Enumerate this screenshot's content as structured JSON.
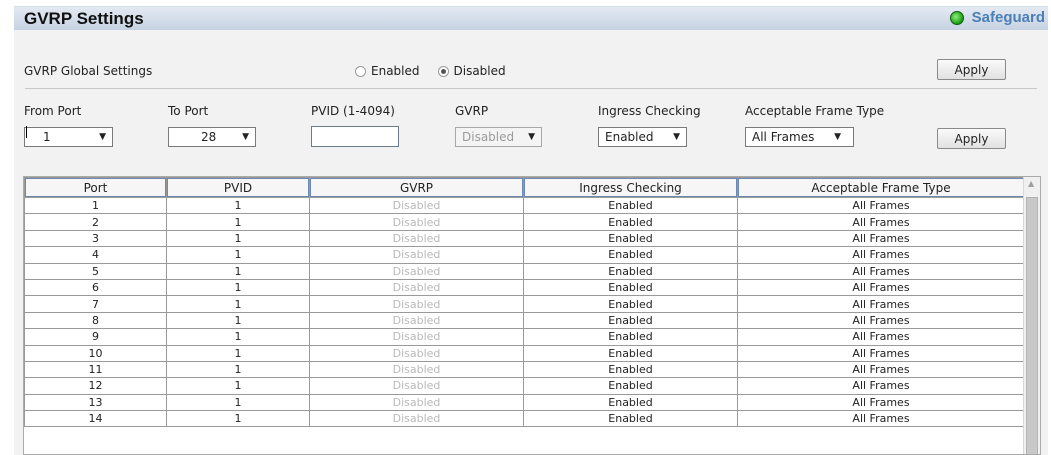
{
  "header": {
    "title": "GVRP Settings",
    "badge": "Safeguard"
  },
  "global": {
    "label": "GVRP Global Settings",
    "options": [
      "Enabled",
      "Disabled"
    ],
    "selected": "Disabled",
    "apply_label": "Apply"
  },
  "form": {
    "from_port": {
      "label": "From Port",
      "value": "1"
    },
    "to_port": {
      "label": "To Port",
      "value": "28"
    },
    "pvid": {
      "label": "PVID (1-4094)",
      "value": ""
    },
    "gvrp": {
      "label": "GVRP",
      "value": "Disabled"
    },
    "ingress": {
      "label": "Ingress Checking",
      "value": "Enabled"
    },
    "frame_type": {
      "label": "Acceptable Frame Type",
      "value": "All Frames"
    },
    "apply_label": "Apply"
  },
  "table": {
    "columns": [
      "Port",
      "PVID",
      "GVRP",
      "Ingress Checking",
      "Acceptable Frame Type"
    ],
    "rows": [
      [
        "1",
        "1",
        "Disabled",
        "Enabled",
        "All Frames"
      ],
      [
        "2",
        "1",
        "Disabled",
        "Enabled",
        "All Frames"
      ],
      [
        "3",
        "1",
        "Disabled",
        "Enabled",
        "All Frames"
      ],
      [
        "4",
        "1",
        "Disabled",
        "Enabled",
        "All Frames"
      ],
      [
        "5",
        "1",
        "Disabled",
        "Enabled",
        "All Frames"
      ],
      [
        "6",
        "1",
        "Disabled",
        "Enabled",
        "All Frames"
      ],
      [
        "7",
        "1",
        "Disabled",
        "Enabled",
        "All Frames"
      ],
      [
        "8",
        "1",
        "Disabled",
        "Enabled",
        "All Frames"
      ],
      [
        "9",
        "1",
        "Disabled",
        "Enabled",
        "All Frames"
      ],
      [
        "10",
        "1",
        "Disabled",
        "Enabled",
        "All Frames"
      ],
      [
        "11",
        "1",
        "Disabled",
        "Enabled",
        "All Frames"
      ],
      [
        "12",
        "1",
        "Disabled",
        "Enabled",
        "All Frames"
      ],
      [
        "13",
        "1",
        "Disabled",
        "Enabled",
        "All Frames"
      ],
      [
        "14",
        "1",
        "Disabled",
        "Enabled",
        "All Frames"
      ]
    ]
  }
}
